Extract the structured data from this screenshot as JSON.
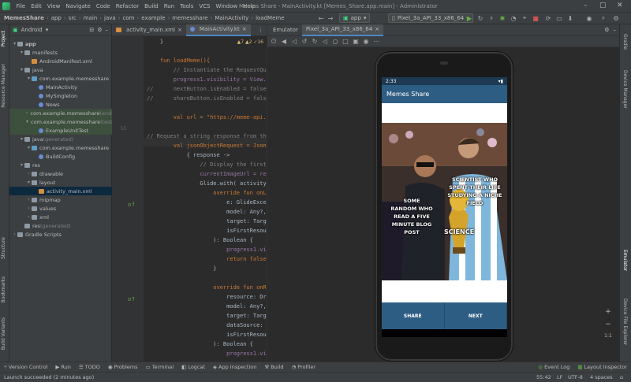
{
  "window": {
    "title": "Memes Share - MainActivity.kt [Memes_Share.app.main] - Administrator"
  },
  "menu": [
    "File",
    "Edit",
    "View",
    "Navigate",
    "Code",
    "Refactor",
    "Build",
    "Run",
    "Tools",
    "VCS",
    "Window",
    "Help"
  ],
  "breadcrumb": [
    "MemesShare",
    "app",
    "src",
    "main",
    "java",
    "com",
    "example",
    "memesshare",
    "MainActivity",
    "loadMeme"
  ],
  "toolbar": {
    "config": "app",
    "device": "Pixel_3a_API_33_x86_64"
  },
  "sidebar_left": [
    "Project",
    "Resource Manager",
    "Structure",
    "Bookmarks",
    "Build Variants"
  ],
  "project": {
    "view": "Android",
    "tree": [
      {
        "label": "app",
        "indent": 0,
        "arrow": "▾",
        "type": "folder",
        "bold": true
      },
      {
        "label": "manifests",
        "indent": 1,
        "arrow": "▾",
        "type": "folder"
      },
      {
        "label": "AndroidManifest.xml",
        "indent": 2,
        "arrow": "",
        "type": "xml"
      },
      {
        "label": "java",
        "indent": 1,
        "arrow": "▾",
        "type": "folder"
      },
      {
        "label": "com.example.memesshare",
        "indent": 2,
        "arrow": "▾",
        "type": "pkg"
      },
      {
        "label": "MainActivity",
        "indent": 3,
        "arrow": "",
        "type": "kt"
      },
      {
        "label": "MySingleton",
        "indent": 3,
        "arrow": "",
        "type": "kt"
      },
      {
        "label": "News",
        "indent": 3,
        "arrow": "",
        "type": "kt"
      },
      {
        "label": "com.example.memesshare",
        "indent": 2,
        "arrow": "›",
        "type": "pkg",
        "state": "hl",
        "suffix": " (androidTest)"
      },
      {
        "label": "com.example.memesshare",
        "indent": 2,
        "arrow": "▾",
        "type": "pkg",
        "state": "hl",
        "suffix": " (test)"
      },
      {
        "label": "ExampleUnitTest",
        "indent": 3,
        "arrow": "",
        "type": "kt",
        "state": "hl"
      },
      {
        "label": "java",
        "indent": 1,
        "arrow": "▾",
        "type": "folder",
        "suffix": " (generated)"
      },
      {
        "label": "com.example.memesshare",
        "indent": 2,
        "arrow": "▾",
        "type": "pkg"
      },
      {
        "label": "BuildConfig",
        "indent": 3,
        "arrow": "",
        "type": "kt"
      },
      {
        "label": "res",
        "indent": 1,
        "arrow": "▾",
        "type": "folder"
      },
      {
        "label": "drawable",
        "indent": 2,
        "arrow": "›",
        "type": "folder"
      },
      {
        "label": "layout",
        "indent": 2,
        "arrow": "▾",
        "type": "folder"
      },
      {
        "label": "activity_main.xml",
        "indent": 3,
        "arrow": "",
        "type": "xml",
        "state": "sel"
      },
      {
        "label": "mipmap",
        "indent": 2,
        "arrow": "›",
        "type": "folder"
      },
      {
        "label": "values",
        "indent": 2,
        "arrow": "›",
        "type": "folder"
      },
      {
        "label": "xml",
        "indent": 2,
        "arrow": "›",
        "type": "folder"
      },
      {
        "label": "res",
        "indent": 1,
        "arrow": "",
        "type": "folder",
        "suffix": " (generated)"
      },
      {
        "label": "Gradle Scripts",
        "indent": 0,
        "arrow": "›",
        "type": "folder"
      }
    ]
  },
  "editor": {
    "tabs": [
      "activity_main.xml",
      "MainActivity.kt"
    ],
    "warnings": "▲7 ▲2 ✓16",
    "lines": [
      {
        "n": "",
        "t": "    }"
      },
      {
        "n": "",
        "t": ""
      },
      {
        "n": "",
        "t": "    fun loadMeme(){"
      },
      {
        "n": "",
        "t": "        // Instantiate the RequestQueue."
      },
      {
        "n": "",
        "t": "        progress1.visibility = View.VISIBLE"
      },
      {
        "n": "",
        "t": "//      nextButton.isEnabled = false"
      },
      {
        "n": "",
        "t": "//      shareButton.isEnabled = false"
      },
      {
        "n": "",
        "t": ""
      },
      {
        "n": "55",
        "t": "        val url = \"https://meme-api.com/gimme\""
      },
      {
        "n": "",
        "t": ""
      },
      {
        "n": "",
        "t": "// Request a string response from the provided URL."
      },
      {
        "n": "",
        "t": "        val jsonObjectRequest = JsonObjectRequest("
      },
      {
        "n": "",
        "t": "            { response ->"
      },
      {
        "n": "",
        "t": "                // Display the first 500 characters"
      },
      {
        "n": "",
        "t": "                currentImageUrl = response.getString("
      },
      {
        "n": "",
        "t": "                Glide.with( activity: this).load(c"
      },
      {
        "n": "",
        "t": "                    override fun onLoadFailed("
      },
      {
        "n": "",
        "t": "                        e: GlideException?,"
      },
      {
        "n": "",
        "t": "                        model: Any?,"
      },
      {
        "n": "",
        "t": "                        target: Target<Drawable>?,"
      },
      {
        "n": "",
        "t": "                        isFirstResource: Boolean"
      },
      {
        "n": "",
        "t": "                    ): Boolean {"
      },
      {
        "n": "",
        "t": "                        progress1.visibility"
      },
      {
        "n": "",
        "t": "                        return false"
      },
      {
        "n": "",
        "t": "                    }"
      },
      {
        "n": "",
        "t": ""
      },
      {
        "n": "",
        "t": "                    override fun onResourceReady("
      },
      {
        "n": "",
        "t": "                        resource: Drawable?,"
      },
      {
        "n": "",
        "t": "                        model: Any?,"
      },
      {
        "n": "",
        "t": "                        target: Target<Drawable>?,"
      },
      {
        "n": "",
        "t": "                        dataSource: DataSource?,"
      },
      {
        "n": "",
        "t": "                        isFirstResource: Boolean"
      },
      {
        "n": "",
        "t": "                    ): Boolean {"
      },
      {
        "n": "",
        "t": "                        progress1.visibility"
      }
    ]
  },
  "emulator": {
    "tabs": [
      "Emulator",
      "Pixel_3a_API_33_x86_64"
    ]
  },
  "phone": {
    "time": "2:33",
    "app_title": "Memes Share",
    "buttons": [
      "SHARE",
      "NEXT"
    ],
    "meme_text": {
      "left": "SOME RANDOM WHO READ A FIVE MINUTE BLOG POST",
      "right": "SCIENTIST WHO SPENT THEIR LIFE STUDYING A NICHE FIELD",
      "bottom": "SCIENCE"
    }
  },
  "sidebar_right": [
    "Gradle",
    "Device Manager",
    "Emulator",
    "Device File Explorer"
  ],
  "zoom": [
    "+",
    "−",
    "1:1"
  ],
  "toolwindows": [
    "Version Control",
    "Run",
    "TODO",
    "Problems",
    "Terminal",
    "Logcat",
    "App Inspection",
    "Build",
    "Profiler"
  ],
  "toolwindows_right": [
    "Event Log",
    "Layout Inspector"
  ],
  "status": {
    "message": "Launch succeeded (2 minutes ago)",
    "pos": "55:42",
    "lf": "LF",
    "enc": "UTF-8",
    "indent": "4 spaces"
  }
}
